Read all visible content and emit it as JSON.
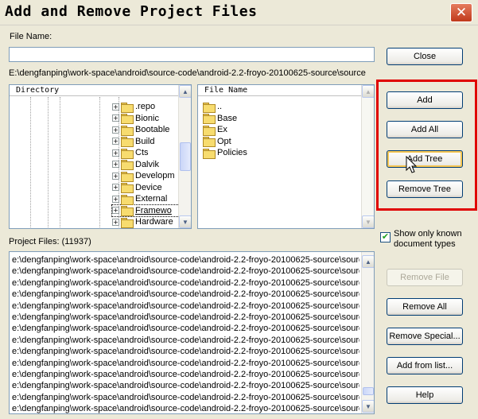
{
  "window": {
    "title": "Add and Remove Project Files",
    "close_glyph": "✕"
  },
  "file_name": {
    "label": "File Name:",
    "value": ""
  },
  "current_path": "E:\\dengfanping\\work-space\\android\\source-code\\android-2.2-froyo-20100625-source\\source",
  "directory": {
    "header": "Directory",
    "items": [
      {
        "label": ".repo"
      },
      {
        "label": "Bionic"
      },
      {
        "label": "Bootable"
      },
      {
        "label": "Build"
      },
      {
        "label": "Cts"
      },
      {
        "label": "Dalvik"
      },
      {
        "label": "Developm"
      },
      {
        "label": "Device"
      },
      {
        "label": "External"
      },
      {
        "label": "Framewo"
      },
      {
        "label": "Hardware"
      }
    ],
    "selected_index": 9
  },
  "files": {
    "header": "File Name",
    "items": [
      {
        "label": ".."
      },
      {
        "label": "Base"
      },
      {
        "label": "Ex"
      },
      {
        "label": "Opt"
      },
      {
        "label": "Policies"
      }
    ]
  },
  "project_files": {
    "label": "Project Files: (11937)",
    "rows": [
      "e:\\dengfanping\\work-space\\android\\source-code\\android-2.2-froyo-20100625-source\\source",
      "e:\\dengfanping\\work-space\\android\\source-code\\android-2.2-froyo-20100625-source\\source",
      "e:\\dengfanping\\work-space\\android\\source-code\\android-2.2-froyo-20100625-source\\source",
      "e:\\dengfanping\\work-space\\android\\source-code\\android-2.2-froyo-20100625-source\\source",
      "e:\\dengfanping\\work-space\\android\\source-code\\android-2.2-froyo-20100625-source\\source",
      "e:\\dengfanping\\work-space\\android\\source-code\\android-2.2-froyo-20100625-source\\source",
      "e:\\dengfanping\\work-space\\android\\source-code\\android-2.2-froyo-20100625-source\\source",
      "e:\\dengfanping\\work-space\\android\\source-code\\android-2.2-froyo-20100625-source\\source",
      "e:\\dengfanping\\work-space\\android\\source-code\\android-2.2-froyo-20100625-source\\source",
      "e:\\dengfanping\\work-space\\android\\source-code\\android-2.2-froyo-20100625-source\\source",
      "e:\\dengfanping\\work-space\\android\\source-code\\android-2.2-froyo-20100625-source\\source",
      "e:\\dengfanping\\work-space\\android\\source-code\\android-2.2-froyo-20100625-source\\source",
      "e:\\dengfanping\\work-space\\android\\source-code\\android-2.2-froyo-20100625-source\\source",
      "e:\\dengfanping\\work-space\\android\\source-code\\android-2.2-froyo-20100625-source\\source"
    ]
  },
  "buttons": {
    "close": "Close",
    "add": "Add",
    "add_all": "Add All",
    "add_tree": "Add Tree",
    "remove_tree": "Remove Tree",
    "remove_file": "Remove File",
    "remove_all": "Remove All",
    "remove_special": "Remove Special...",
    "add_from_list": "Add from list...",
    "help": "Help"
  },
  "show_known": {
    "label": "Show only known document types",
    "checked": true,
    "check_glyph": "✔"
  },
  "icons": {
    "expand": "+",
    "scroll_up": "▲",
    "scroll_down": "▼",
    "cursor": "arrow-pointer-icon"
  },
  "colors": {
    "highlight_box": "#e00000",
    "dialog_bg": "#ece9d8"
  }
}
